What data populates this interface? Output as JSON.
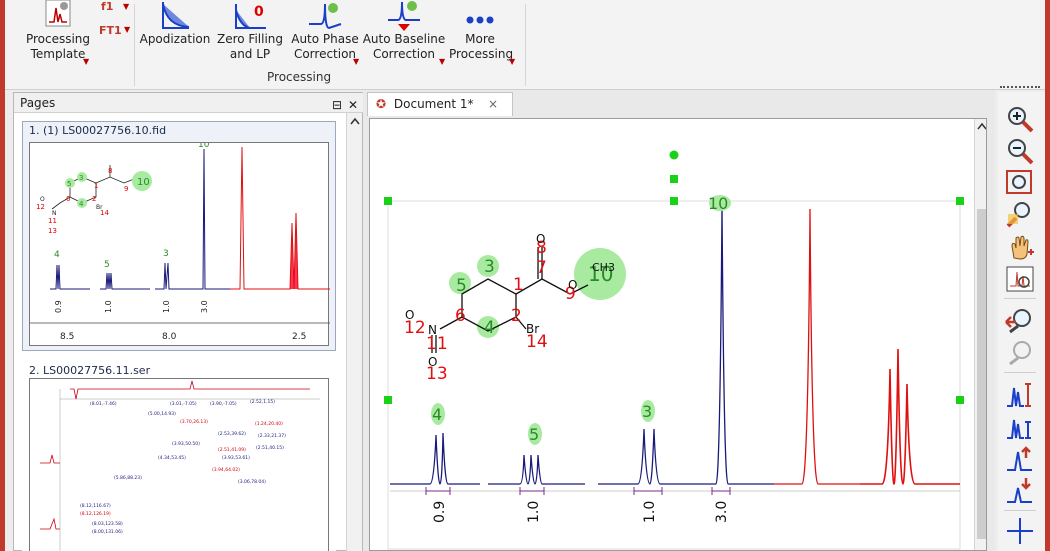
{
  "ribbon": {
    "processing_template": "Processing\nTemplate",
    "ft_top": "f1",
    "ft_bottom": "FT1",
    "apodization": "Apodization",
    "zero_filling": "Zero Filling\nand LP",
    "auto_phase": "Auto Phase\nCorrection",
    "auto_baseline": "Auto Baseline\nCorrection",
    "more": "More\nProcessing",
    "group_label": "Processing"
  },
  "pages_panel": {
    "title": "Pages",
    "pin_glyph": "⊟",
    "close_glyph": "✕",
    "items": [
      {
        "title": "1. (1) LS00027756.10.fid",
        "axis": [
          "8.5",
          "8.0",
          "2.5"
        ],
        "integrals": [
          "0.9",
          "1.0",
          "1.0",
          "3.0"
        ],
        "peaks": [
          "4",
          "5",
          "3",
          "10"
        ]
      },
      {
        "title": "2. LS00027756.11.ser"
      }
    ]
  },
  "document": {
    "tab_label": "Document 1*",
    "close_glyph": "×",
    "molecule": {
      "labels": [
        "3",
        "5",
        "1",
        "7",
        "8",
        "6",
        "4",
        "2",
        "10",
        "9",
        "12",
        "11",
        "13",
        "14"
      ],
      "atoms": [
        "O",
        "O",
        "O",
        "N",
        "O",
        "Br",
        "CH3"
      ]
    },
    "peaks": [
      {
        "label": "4",
        "integral": "0.9"
      },
      {
        "label": "5",
        "integral": "1.0"
      },
      {
        "label": "3",
        "integral": "1.0"
      },
      {
        "label": "10",
        "integral": "3.0"
      }
    ]
  },
  "colors": {
    "accent": "#c0392b",
    "spectrum_blue": "#1a1a7a",
    "spectrum_red": "#e01010",
    "highlight": "#a8eba0"
  },
  "thumb2_labels": [
    "(8.01,-7.46)",
    "(5.00,14.93)",
    "(3.70,26.13)",
    "(3.01,-7.05)",
    "(3.90,-7.05)",
    "(2.52,1.15)",
    "(1.24,20.40)",
    "(2.53,39.62)",
    "(2.33,21.37)",
    "(3.93,50.50)",
    "(2.51,41.09)",
    "(2.51,40.15)",
    "(4.34,53.45)",
    "(3.93,53.61)",
    "(3.94,64.02)",
    "(5.86,88.23)",
    "(3.06,78.04)",
    "(8.12,116.67)",
    "(8.12,126.19)",
    "(8.03,123.58)",
    "(8.00,131.06)"
  ]
}
